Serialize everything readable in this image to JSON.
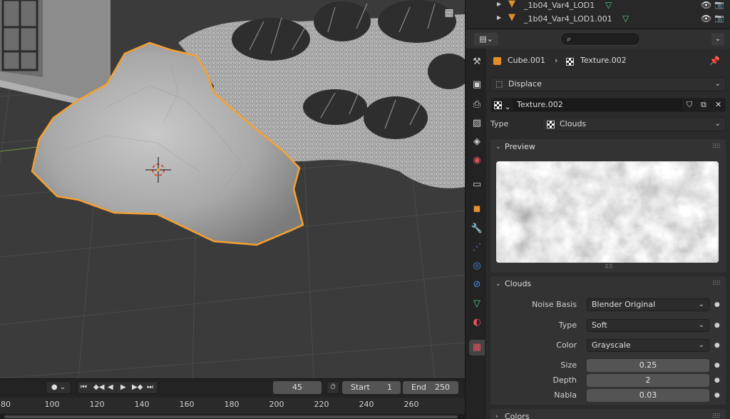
{
  "outliner": {
    "rows": [
      {
        "name": "_1b04_Var4_LOD1"
      },
      {
        "name": "_1b04_Var4_LOD1.001"
      }
    ]
  },
  "header": {
    "editor_icon": "properties-editor-icon",
    "search_placeholder": "",
    "search_icon": "search-icon"
  },
  "tabs": [
    {
      "name": "tool-tab",
      "icon": "tool-icon",
      "glyph": "⚒",
      "color": "#d0d0d0"
    },
    {
      "name": "render-tab",
      "icon": "camera-back-icon",
      "glyph": "▣",
      "color": "#d0d0d0"
    },
    {
      "name": "output-tab",
      "icon": "printer-icon",
      "glyph": "⎙",
      "color": "#d0d0d0"
    },
    {
      "name": "view-layer-tab",
      "icon": "image-icon",
      "glyph": "▨",
      "color": "#d0d0d0"
    },
    {
      "name": "scene-tab",
      "icon": "scene-icon",
      "glyph": "◈",
      "color": "#d0d0d0"
    },
    {
      "name": "world-tab",
      "icon": "world-icon",
      "glyph": "◉",
      "color": "#e0515b"
    },
    {
      "name": "collection-tab",
      "icon": "collection-icon",
      "glyph": "▭",
      "color": "#d0d0d0"
    },
    {
      "name": "object-tab",
      "icon": "object-icon",
      "glyph": "◼",
      "color": "#e89030"
    },
    {
      "name": "modifier-tab",
      "icon": "wrench-icon",
      "glyph": "🔧",
      "color": "#4c8cf0"
    },
    {
      "name": "particles-tab",
      "icon": "particles-icon",
      "glyph": "⋰",
      "color": "#4c8cf0"
    },
    {
      "name": "physics-tab",
      "icon": "physics-icon",
      "glyph": "◎",
      "color": "#4c8cf0"
    },
    {
      "name": "constraints-tab",
      "icon": "constraint-icon",
      "glyph": "⊘",
      "color": "#4c8cf0"
    },
    {
      "name": "data-tab",
      "icon": "mesh-data-icon",
      "glyph": "▽",
      "color": "#4fd18b"
    },
    {
      "name": "material-tab",
      "icon": "material-icon",
      "glyph": "◐",
      "color": "#e0515b"
    },
    {
      "name": "texture-tab",
      "icon": "texture-icon",
      "glyph": "▦",
      "color": "#e0515b"
    }
  ],
  "breadcrumb": {
    "object": "Cube.001",
    "separator": "›",
    "texture": "Texture.002"
  },
  "modifier_select": "Displace",
  "texture_block": {
    "name": "Texture.002"
  },
  "type_row": {
    "label": "Type",
    "value": "Clouds"
  },
  "preview_panel": {
    "title": "Preview"
  },
  "clouds_panel": {
    "title": "Clouds",
    "fields": [
      {
        "label": "Noise Basis",
        "value": "Blender Original",
        "kind": "dropdown"
      },
      {
        "label": "Type",
        "value": "Soft",
        "kind": "dropdown"
      },
      {
        "label": "Color",
        "value": "Grayscale",
        "kind": "dropdown"
      },
      {
        "label": "Size",
        "value": "0.25",
        "kind": "number"
      },
      {
        "label": "Depth",
        "value": "2",
        "kind": "number"
      },
      {
        "label": "Nabla",
        "value": "0.03",
        "kind": "number"
      }
    ]
  },
  "colors_panel": {
    "title": "Colors"
  },
  "timeline": {
    "current_frame": "45",
    "start_label": "Start",
    "start_value": "1",
    "end_label": "End",
    "end_value": "250",
    "ruler": [
      "80",
      "100",
      "120",
      "140",
      "160",
      "180",
      "200",
      "220",
      "240",
      "260"
    ]
  },
  "colors": {
    "selection_outline": "#f5a030",
    "mesh_icon": "#4fd18b",
    "object_icon": "#e0902b"
  }
}
